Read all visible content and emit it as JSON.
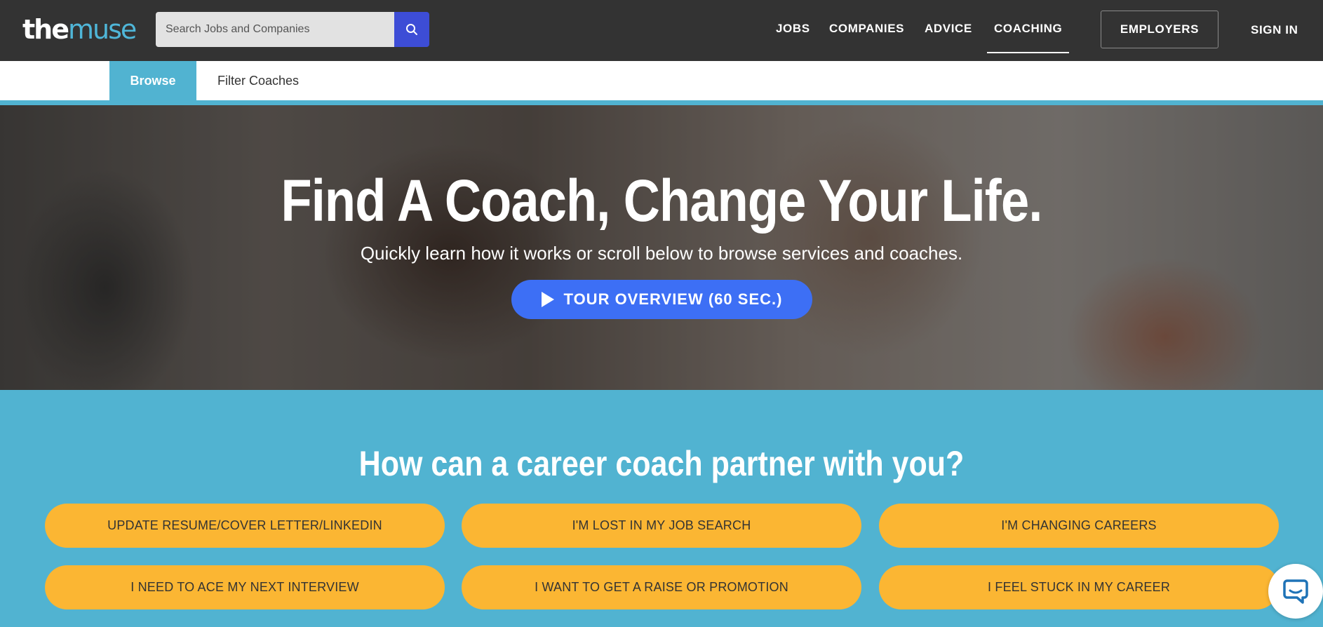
{
  "header": {
    "logo_the": "the",
    "logo_muse": "muse",
    "search_placeholder": "Search Jobs and Companies",
    "nav": {
      "jobs": "JOBS",
      "companies": "COMPANIES",
      "advice": "ADVICE",
      "coaching": "COACHING",
      "employers": "EMPLOYERS",
      "sign_in": "SIGN IN"
    }
  },
  "subnav": {
    "browse": "Browse",
    "filter": "Filter Coaches"
  },
  "hero": {
    "title": "Find A Coach, Change Your Life.",
    "subtitle": "Quickly learn how it works or scroll below to browse services and coaches.",
    "tour_button": "TOUR OVERVIEW (60 SEC.)"
  },
  "career": {
    "title": "How can a career coach partner with you?",
    "options": [
      "UPDATE RESUME/COVER LETTER/LINKEDIN",
      "I'M LOST IN MY JOB SEARCH",
      "I'M CHANGING CAREERS",
      "I NEED TO ACE MY NEXT INTERVIEW",
      "I WANT TO GET A RAISE OR PROMOTION",
      "I FEEL STUCK IN MY CAREER"
    ]
  },
  "icons": {
    "search": "search-icon",
    "play": "play-icon",
    "chat": "chat-icon"
  },
  "colors": {
    "header_bg": "#333333",
    "accent_teal": "#51b3d1",
    "search_button": "#3d4dd6",
    "tour_button": "#3d6ff5",
    "pill_yellow": "#fbb633"
  }
}
